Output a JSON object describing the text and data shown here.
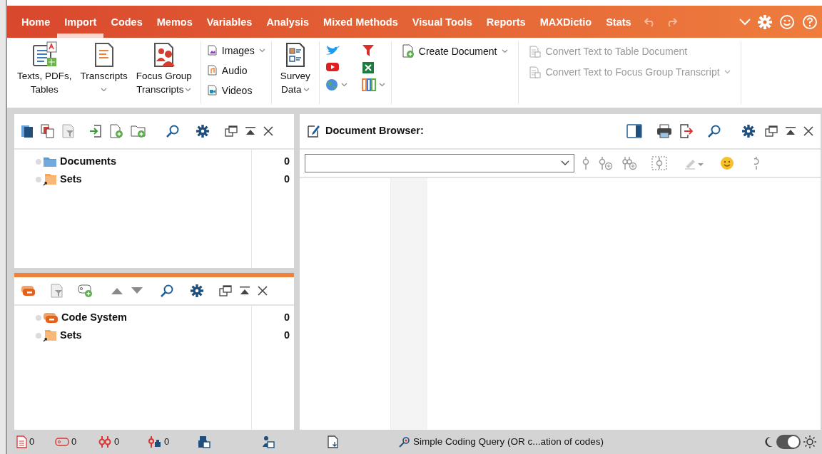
{
  "tabs": [
    {
      "label": "Home",
      "selected": false
    },
    {
      "label": "Import",
      "selected": true
    },
    {
      "label": "Codes",
      "selected": false
    },
    {
      "label": "Memos",
      "selected": false
    },
    {
      "label": "Variables",
      "selected": false
    },
    {
      "label": "Analysis",
      "selected": false
    },
    {
      "label": "Mixed Methods",
      "selected": false
    },
    {
      "label": "Visual Tools",
      "selected": false
    },
    {
      "label": "Reports",
      "selected": false
    },
    {
      "label": "MAXDictio",
      "selected": false
    },
    {
      "label": "Stats",
      "selected": false
    }
  ],
  "ribbon": {
    "import_buttons": [
      {
        "lines": [
          "Texts, PDFs,",
          "Tables"
        ],
        "has_menu": false
      },
      {
        "lines": [
          "Transcripts"
        ],
        "has_menu": true
      },
      {
        "lines": [
          "Focus Group",
          "Transcripts"
        ],
        "has_menu": true
      }
    ],
    "media_buttons": [
      {
        "label": "Images",
        "has_menu": true
      },
      {
        "label": "Audio",
        "has_menu": false
      },
      {
        "label": "Videos",
        "has_menu": false
      }
    ],
    "survey_button": {
      "lines": [
        "Survey",
        "Data"
      ],
      "has_menu": true
    },
    "create_button": {
      "label": "Create Document",
      "has_menu": true,
      "disabled": false
    },
    "convert_buttons": [
      {
        "label": "Convert Text to Table Document",
        "has_menu": false,
        "disabled": true
      },
      {
        "label": "Convert Text to Focus Group Transcript",
        "has_menu": true,
        "disabled": true
      }
    ]
  },
  "document_system": {
    "items": [
      {
        "kind": "folder",
        "label": "Documents",
        "count": "0"
      },
      {
        "kind": "set",
        "label": "Sets",
        "count": "0"
      }
    ]
  },
  "code_system": {
    "items": [
      {
        "kind": "codes",
        "label": "Code System",
        "count": "0"
      },
      {
        "kind": "set",
        "label": "Sets",
        "count": "0"
      }
    ]
  },
  "document_browser": {
    "title": "Document Browser:"
  },
  "status_bar": {
    "counts": [
      "0",
      "0",
      "0",
      "0"
    ],
    "query": "Simple Coding Query (OR c...ation of codes)",
    "light_mode": true
  }
}
